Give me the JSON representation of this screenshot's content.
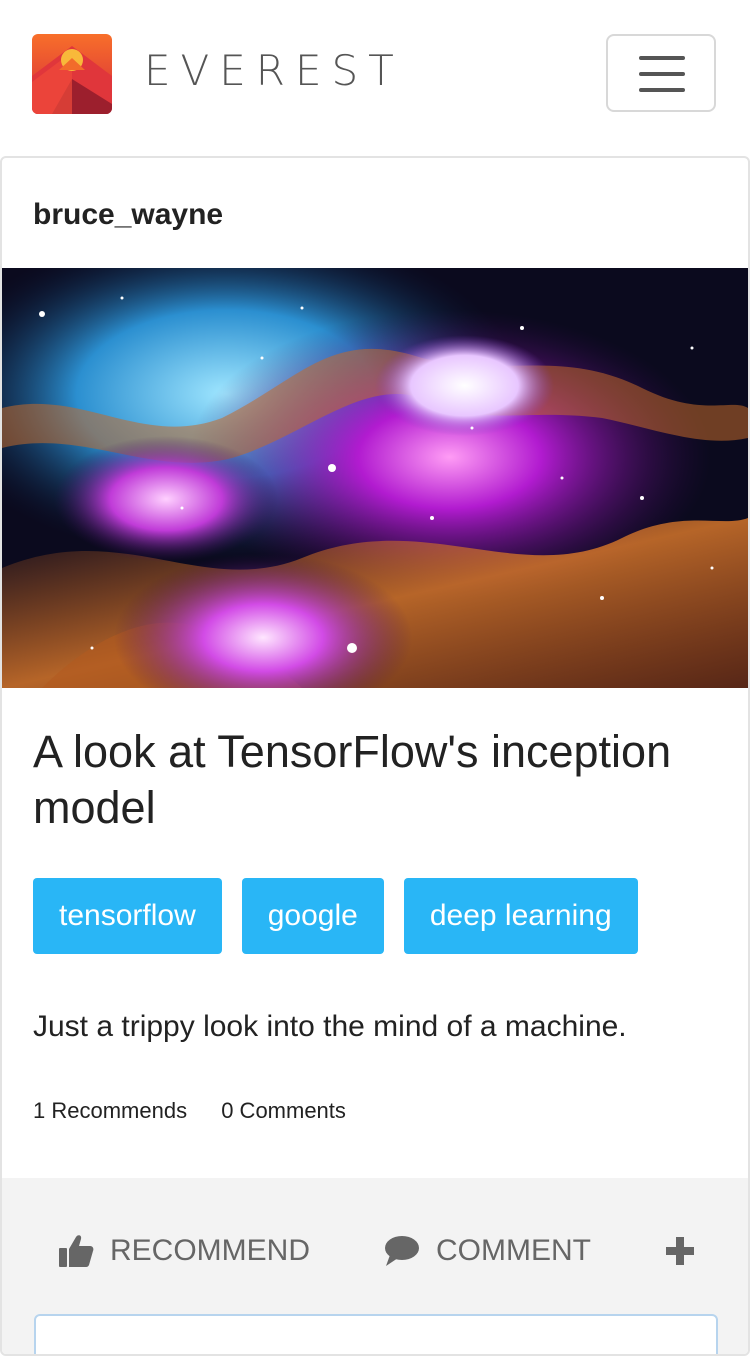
{
  "brand": {
    "name": "EVEREST",
    "logo_icon": "mountain-logo-icon"
  },
  "post": {
    "author": "bruce_wayne",
    "title": "A look at TensorFlow's inception model",
    "tags": [
      "tensorflow",
      "google",
      "deep learning"
    ],
    "description": "Just a trippy look into the mind of a machine.",
    "stats": {
      "recommends": "1 Recommends",
      "comments": "0 Comments"
    },
    "actions": {
      "recommend": "RECOMMEND",
      "comment": "COMMENT"
    }
  },
  "colors": {
    "accent": "#29b6f6",
    "logo_top": "#f5a623",
    "logo_bottom": "#c62828"
  }
}
